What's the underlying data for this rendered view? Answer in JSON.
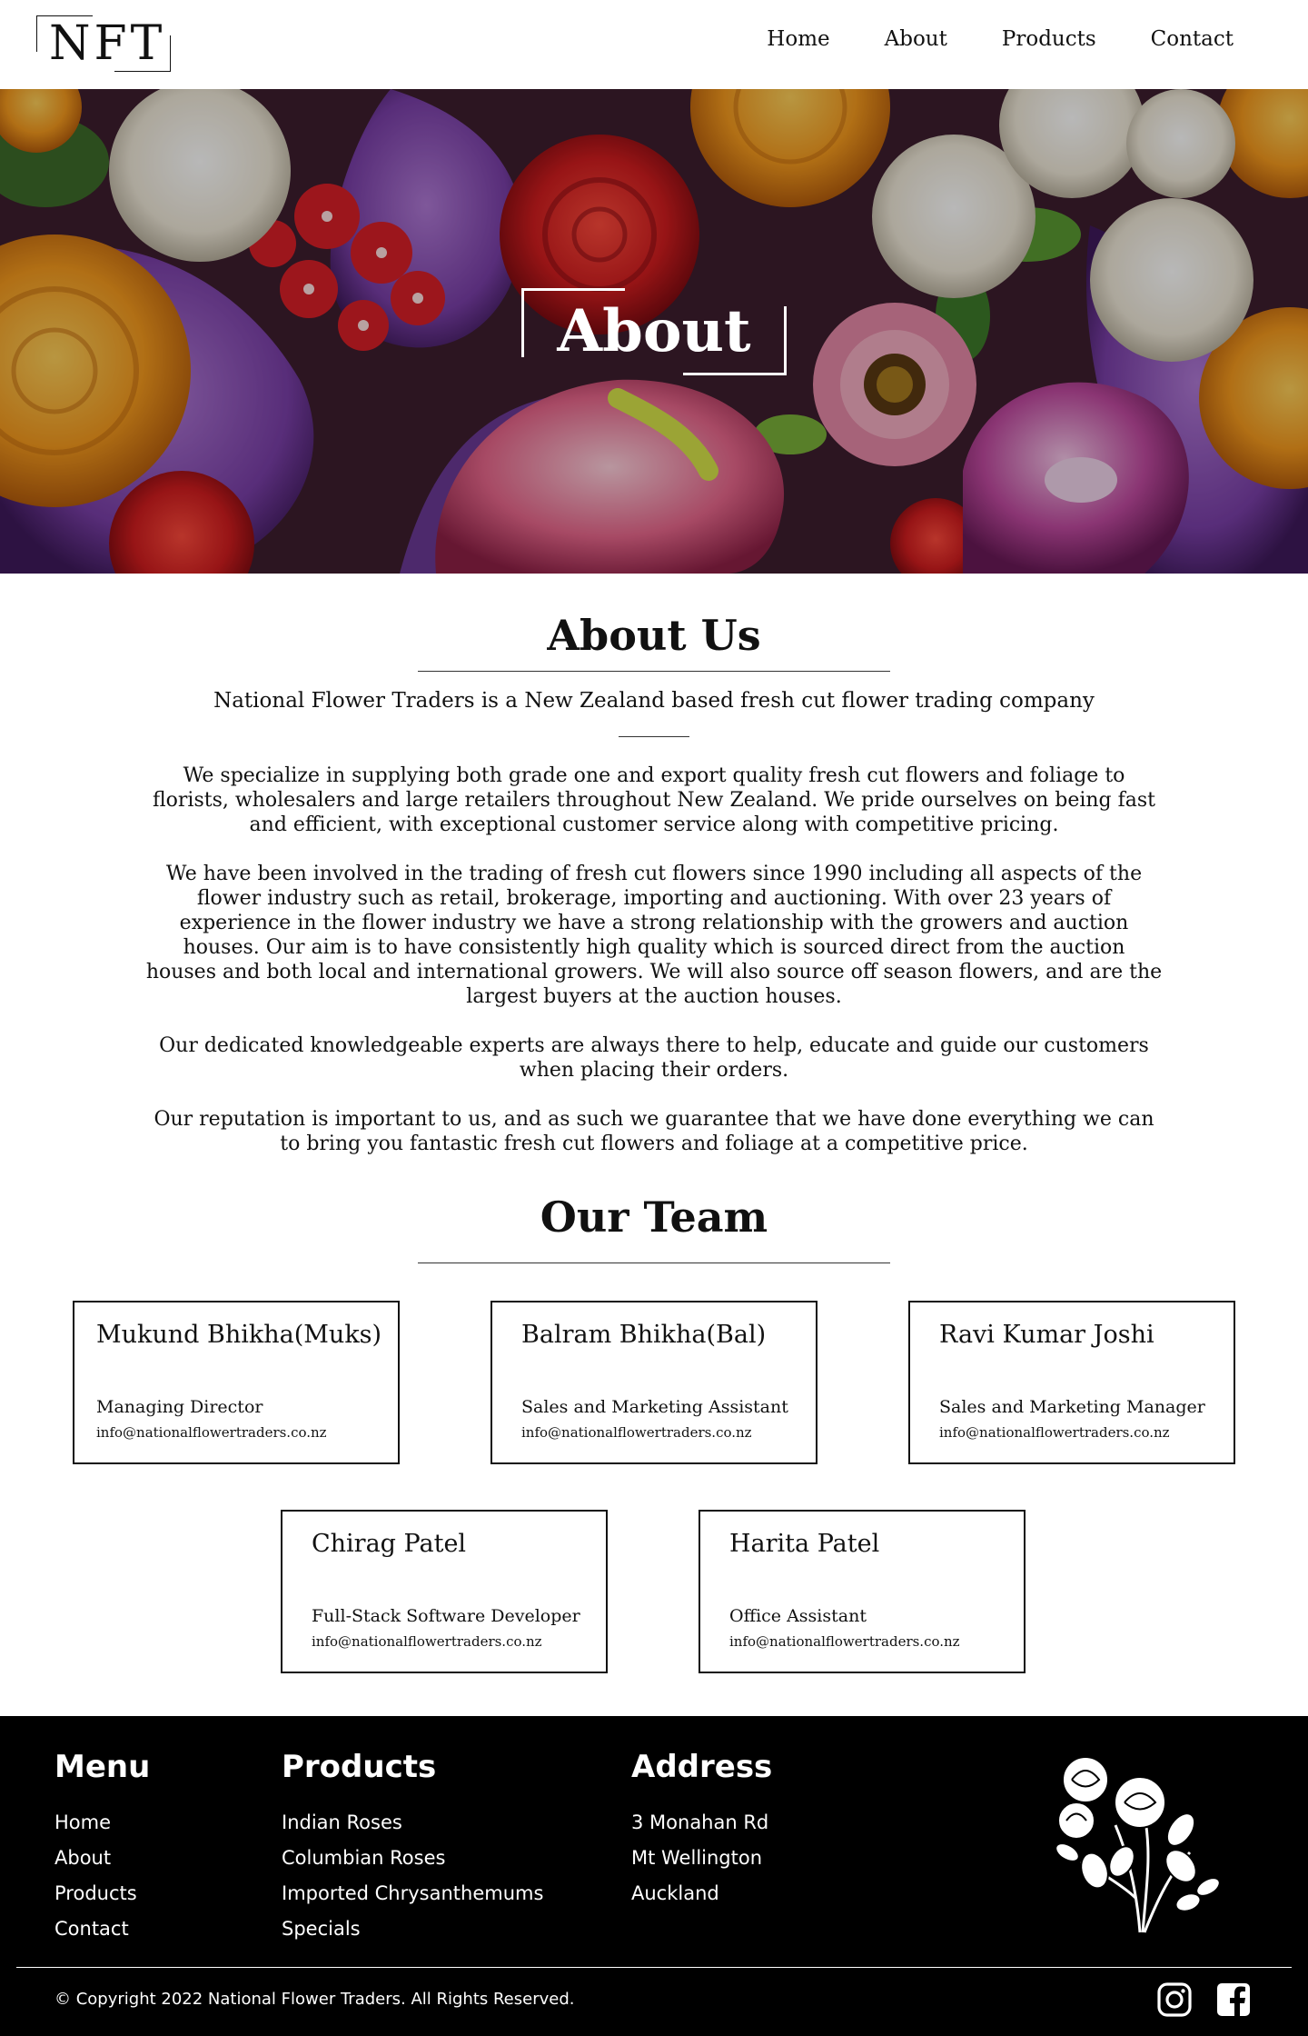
{
  "brand": {
    "logo_text": "NFT"
  },
  "nav": {
    "items": [
      {
        "label": "Home"
      },
      {
        "label": "About"
      },
      {
        "label": "Products"
      },
      {
        "label": "Contact"
      }
    ]
  },
  "hero": {
    "title": "About"
  },
  "about": {
    "heading": "About Us",
    "tagline": "National Flower Traders is a New Zealand based fresh cut flower trading company",
    "paragraphs": [
      "We specialize in supplying both grade one and export quality fresh cut flowers and foliage to florists, wholesalers and large retailers throughout New Zealand. We pride ourselves on being fast and efficient, with exceptional customer service along with competitive pricing.",
      "We have been involved in the trading of fresh cut flowers since 1990 including all aspects of the flower industry such as retail, brokerage, importing and auctioning. With over 23 years of experience in the flower industry we have a strong relationship with the growers and auction houses. Our aim is to have consistently high quality which is sourced direct from the auction houses and both local and international growers. We will also source off season flowers, and are the largest buyers at the auction houses.",
      "Our dedicated knowledgeable experts are always there to help, educate and guide our customers when placing their orders.",
      "Our reputation is important to us, and as such we guarantee that we have done everything we can to bring you fantastic fresh cut flowers and foliage at a competitive price."
    ]
  },
  "team": {
    "heading": "Our Team",
    "members": [
      {
        "name": "Mukund Bhikha(Muks)",
        "role": "Managing Director",
        "email": "info@nationalflowertraders.co.nz"
      },
      {
        "name": "Balram Bhikha(Bal)",
        "role": "Sales and Marketing Assistant",
        "email": "info@nationalflowertraders.co.nz"
      },
      {
        "name": "Ravi Kumar Joshi",
        "role": "Sales and Marketing Manager",
        "email": "info@nationalflowertraders.co.nz"
      },
      {
        "name": "Chirag Patel",
        "role": "Full-Stack Software Developer",
        "email": "info@nationalflowertraders.co.nz"
      },
      {
        "name": "Harita Patel",
        "role": "Office Assistant",
        "email": "info@nationalflowertraders.co.nz"
      }
    ]
  },
  "footer": {
    "menu": {
      "heading": "Menu",
      "items": [
        "Home",
        "About",
        "Products",
        "Contact"
      ]
    },
    "products": {
      "heading": "Products",
      "items": [
        "Indian Roses",
        "Columbian Roses",
        "Imported Chrysanthemums",
        "Specials"
      ]
    },
    "address": {
      "heading": "Address",
      "lines": [
        "3 Monahan Rd",
        "Mt Wellington",
        "Auckland"
      ]
    },
    "copyright": "© Copyright 2022 National Flower Traders. All Rights Reserved.",
    "social_icons": [
      "instagram-icon",
      "facebook-icon"
    ]
  },
  "colors": {
    "background": "#ffffff",
    "text": "#111111",
    "footer_bg": "#000000",
    "footer_text": "#ffffff"
  }
}
